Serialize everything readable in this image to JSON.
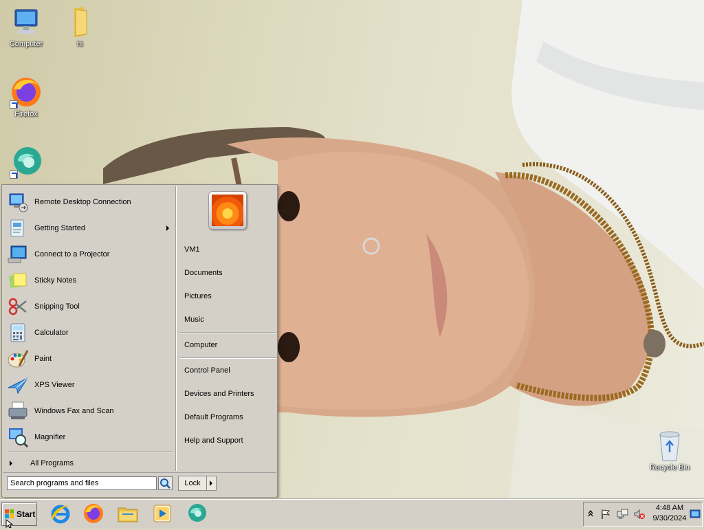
{
  "desktop": {
    "icons": [
      {
        "label": "Computer",
        "icon": "computer-icon"
      },
      {
        "label": "hi",
        "icon": "folder-icon"
      },
      {
        "label": "Firefox",
        "icon": "firefox-icon"
      },
      {
        "label": "",
        "icon": "app-icon"
      },
      {
        "label": "Recycle Bin",
        "icon": "recycle-bin-icon"
      }
    ]
  },
  "start_menu": {
    "programs": [
      {
        "label": "Remote Desktop Connection",
        "icon": "remote-desktop-icon"
      },
      {
        "label": "Getting Started",
        "icon": "getting-started-icon",
        "submenu": true
      },
      {
        "label": "Connect to a Projector",
        "icon": "projector-icon"
      },
      {
        "label": "Sticky Notes",
        "icon": "sticky-notes-icon"
      },
      {
        "label": "Snipping Tool",
        "icon": "scissors-icon"
      },
      {
        "label": "Calculator",
        "icon": "calculator-icon"
      },
      {
        "label": "Paint",
        "icon": "paint-icon"
      },
      {
        "label": "XPS Viewer",
        "icon": "xps-viewer-icon"
      },
      {
        "label": "Windows Fax and Scan",
        "icon": "fax-icon"
      },
      {
        "label": "Magnifier",
        "icon": "magnifier-icon"
      }
    ],
    "all_programs": "All Programs",
    "right": {
      "user": "VM1",
      "links1": [
        "Documents",
        "Pictures",
        "Music"
      ],
      "links2": [
        "Computer"
      ],
      "links3": [
        "Control Panel",
        "Devices and Printers",
        "Default Programs",
        "Help and Support"
      ]
    },
    "search": {
      "placeholder": "Search programs and files"
    },
    "lock_label": "Lock"
  },
  "taskbar": {
    "start_label": "Start",
    "pinned": [
      "internet-explorer-icon",
      "firefox-icon",
      "file-explorer-icon",
      "media-player-icon",
      "app-icon"
    ],
    "clock": {
      "time": "4:48 AM",
      "date": "9/30/2024"
    }
  },
  "colors": {
    "taskbar": "#d4d0c8",
    "menu": "#d4d0c8"
  }
}
